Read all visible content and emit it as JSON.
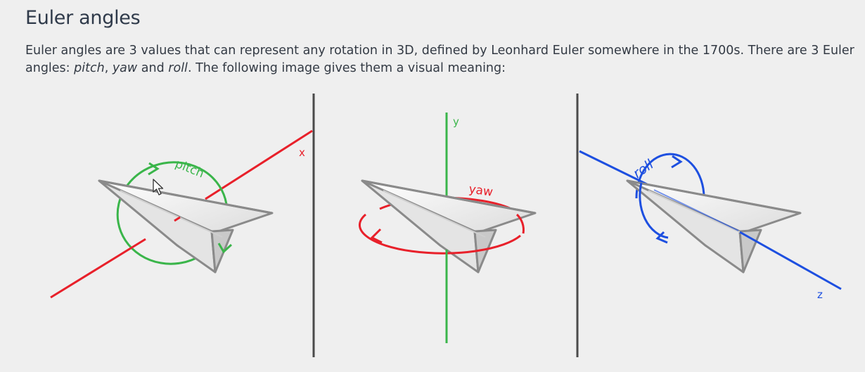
{
  "heading": "Euler angles",
  "paragraph": {
    "part1": "Euler angles are 3 values that can represent any rotation in 3D, defined by Leonhard Euler somewhere in the 1700s. There are 3 Euler angles: ",
    "pitch": "pitch",
    "sep1": ", ",
    "yaw": "yaw",
    "sep2": " and ",
    "roll": "roll",
    "part2": ". The following image gives them a visual meaning:"
  },
  "diagram": {
    "panels": [
      {
        "axis_label": "x",
        "rotation_label": "pitch",
        "color": "#e8202a"
      },
      {
        "axis_label": "y",
        "rotation_label": "yaw",
        "color": "#3ab54a"
      },
      {
        "axis_label": "z",
        "rotation_label": "roll",
        "color": "#1d4fe0"
      }
    ],
    "pitch_arrow_color": "#3ab54a",
    "yaw_arrow_color": "#e8202a",
    "roll_arrow_color": "#1d4fe0",
    "icons": [
      "paper-plane-icon",
      "mouse-cursor-icon"
    ]
  }
}
